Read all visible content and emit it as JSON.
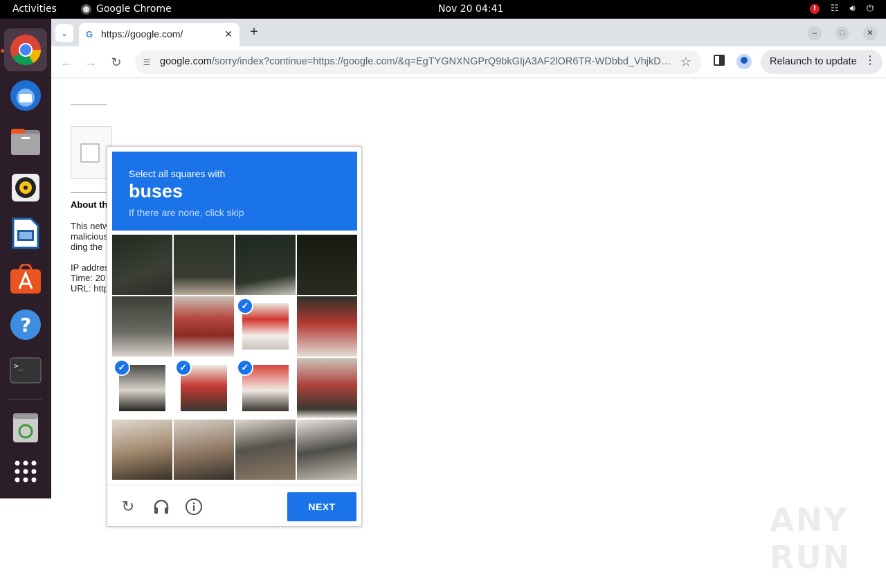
{
  "topbar": {
    "activities": "Activities",
    "app_name": "Google Chrome",
    "clock": "Nov 20  04:41",
    "alert_badge": "!"
  },
  "dock": {
    "items": [
      "chrome",
      "thunderbird",
      "files",
      "rhythmbox",
      "writer",
      "app-center",
      "help",
      "terminal",
      "trash",
      "show-apps"
    ]
  },
  "browser": {
    "tab_title": "https://google.com/",
    "tab_favicon": "G",
    "url_host": "google.com",
    "url_path": "/sorry/index?continue=https://google.com/&q=EgTYGNXNGPrQ9bkGIjA3AF2lOR6TR-WDbbd_VhjkDjwO...",
    "relaunch_label": "Relaunch to update"
  },
  "page": {
    "about_heading": "About th",
    "lines": [
      "This netw",
      "malicious",
      "ding the",
      "IP addres",
      "Time: 20",
      "URL: http"
    ]
  },
  "captcha": {
    "instruction": "Select all squares with",
    "target": "buses",
    "skip_hint": "If there are none, click skip",
    "next_label": "NEXT",
    "selected_tiles": [
      6,
      8,
      9,
      10
    ],
    "accent_color": "#1a73e8"
  },
  "watermark": "ANY RUN"
}
